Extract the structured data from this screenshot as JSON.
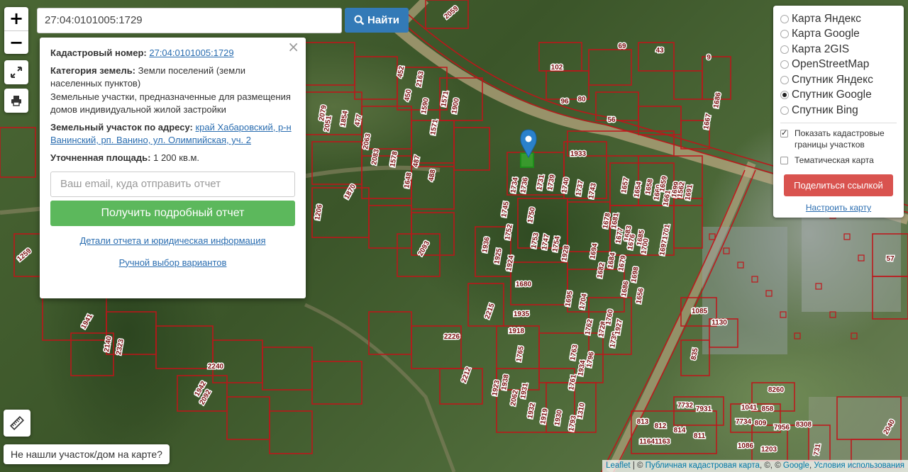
{
  "search": {
    "value": "27:04:0101005:1729",
    "button_label": "Найти"
  },
  "zoom": {
    "in": "+",
    "out": "−"
  },
  "popup": {
    "close": "×",
    "cadastral_label": "Кадастровый номер:",
    "cadastral_value": "27:04:0101005:1729",
    "category_label": "Категория земель:",
    "category_value": "Земли поселений (земли населенных пунктов)",
    "purpose_value": "Земельные участки, предназначенные для размещения домов индивидуальной жилой застройки",
    "address_label": "Земельный участок по адресу:",
    "address_value": "край Хабаровский, р-н Ванинский, рп. Ванино, ул. Олимпийская, уч. 2",
    "area_label": "Уточненная площадь:",
    "area_value": "1 200 кв.м.",
    "email_placeholder": "Ваш email, куда отправить отчет",
    "report_button": "Получить подробный отчет",
    "details_link": "Детали отчета и юридическая информация",
    "manual_link": "Ручной выбор вариантов"
  },
  "layers": {
    "base": [
      {
        "label": "Карта Яндекс",
        "selected": false
      },
      {
        "label": "Карта Google",
        "selected": false
      },
      {
        "label": "Карта 2GIS",
        "selected": false
      },
      {
        "label": "OpenStreetMap",
        "selected": false
      },
      {
        "label": "Спутник Яндекс",
        "selected": false
      },
      {
        "label": "Спутник Google",
        "selected": true
      },
      {
        "label": "Спутник Bing",
        "selected": false
      }
    ],
    "show_cadastral": "Показать кадастровые границы участков",
    "thematic_map": "Тематическая карта",
    "share_button": "Поделиться ссылкой",
    "settings_link": "Настроить карту"
  },
  "not_found_button": "Не нашли участок/дом на карте?",
  "attribution": {
    "leaflet": "Leaflet",
    "sep1": " | © ",
    "pkk": "Публичная кадастровая карта",
    "sep2": ", ©, © ",
    "google": "Google",
    "sep3": ", ",
    "terms": "Условия использования"
  },
  "map_labels": [
    "1933",
    "1734",
    "1736",
    "1731",
    "1739",
    "1740",
    "1737",
    "1743",
    "1745",
    "1750",
    "1752",
    "1753",
    "1747",
    "1754",
    "1928",
    "1936",
    "1925",
    "1924",
    "1680",
    "1694",
    "1682",
    "1684",
    "1679",
    "1678",
    "1681",
    "1677",
    "1683",
    "1676",
    "1685",
    "1700",
    "1701",
    "1697",
    "1686",
    "1698",
    "1656",
    "1657",
    "1654",
    "1658",
    "1660",
    "1659",
    "1661",
    "1699",
    "1562",
    "1691",
    "1695",
    "1704",
    "1762",
    "1728",
    "1760",
    "1739",
    "1927",
    "1935",
    "1918",
    "1765",
    "1763",
    "1796",
    "1761",
    "1934",
    "1923",
    "1938",
    "2062",
    "1931",
    "1932",
    "1919",
    "1930",
    "1793",
    "1310",
    "2215",
    "2226",
    "2212",
    "2240",
    "2093",
    "1941",
    "2140",
    "2323",
    "1942",
    "2092",
    "1259",
    "1870",
    "1206",
    "1648",
    "2083",
    "1578",
    "2063",
    "487",
    "488",
    "477",
    "1854",
    "2079",
    "2051",
    "1590",
    "1571",
    "1900",
    "1571",
    "2163",
    "450",
    "452",
    "69",
    "43",
    "9",
    "102",
    "96",
    "80",
    "56",
    "1667",
    "1686",
    "1085",
    "1130",
    "835",
    "8260",
    "7732",
    "7931",
    "1041",
    "858",
    "7734",
    "809",
    "7956",
    "8308",
    "813",
    "812",
    "814",
    "811",
    "11641163",
    "1086",
    "1203",
    "731",
    "2059",
    "57",
    "2040"
  ]
}
